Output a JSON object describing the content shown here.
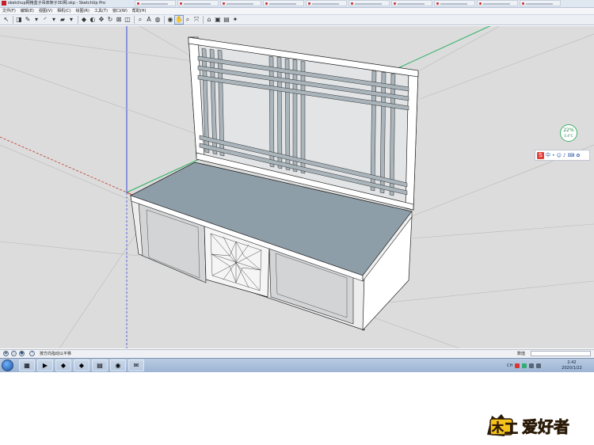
{
  "window": {
    "title": "sketchup网格盒子吊床架子3D网.skp - SketchUp Pro"
  },
  "menu": {
    "items": [
      "文件(F)",
      "编辑(E)",
      "视图(V)",
      "相机(C)",
      "绘图(R)",
      "工具(T)",
      "窗口(W)",
      "帮助(H)"
    ]
  },
  "toolbar": {
    "tools": [
      {
        "name": "select-tool-icon",
        "glyph": "↖"
      },
      {
        "name": "eraser-tool-icon",
        "glyph": "◨"
      },
      {
        "name": "pencil-tool-icon",
        "glyph": "✎"
      },
      {
        "name": "dropdown-icon",
        "glyph": "▾"
      },
      {
        "name": "arc-tool-icon",
        "glyph": "◜"
      },
      {
        "name": "dropdown-icon",
        "glyph": "▾"
      },
      {
        "name": "shape-tool-icon",
        "glyph": "▰"
      },
      {
        "name": "dropdown-icon",
        "glyph": "▾"
      },
      {
        "name": "push-pull-icon",
        "glyph": "◆"
      },
      {
        "name": "follow-me-icon",
        "glyph": "◐"
      },
      {
        "name": "move-tool-icon",
        "glyph": "✥"
      },
      {
        "name": "rotate-tool-icon",
        "glyph": "↻"
      },
      {
        "name": "scale-tool-icon",
        "glyph": "⊠"
      },
      {
        "name": "offset-tool-icon",
        "glyph": "◫"
      },
      {
        "name": "tape-measure-icon",
        "glyph": "⌕"
      },
      {
        "name": "text-tool-icon",
        "glyph": "A"
      },
      {
        "name": "paint-bucket-icon",
        "glyph": "◍"
      },
      {
        "name": "orbit-tool-icon",
        "glyph": "◉"
      },
      {
        "name": "pan-tool-icon",
        "glyph": "✋"
      },
      {
        "name": "zoom-tool-icon",
        "glyph": "⌕"
      },
      {
        "name": "zoom-extents-icon",
        "glyph": "⤧"
      },
      {
        "name": "warehouse-icon",
        "glyph": "⌂"
      },
      {
        "name": "extension-warehouse-icon",
        "glyph": "▣"
      },
      {
        "name": "layout-icon",
        "glyph": "▤"
      },
      {
        "name": "extension-manager-icon",
        "glyph": "✦"
      }
    ]
  },
  "zoom_widget": {
    "percent": "22%",
    "sub": "0.4°C"
  },
  "ime": {
    "logo": "S"
  },
  "status": {
    "hint": "按方向指动以平移",
    "measure_label": "数值"
  },
  "tray": {
    "lang": "CH"
  },
  "clock": {
    "time": "2:42",
    "date": "2020/1/22"
  },
  "brand": {
    "text": "木工爱好者"
  },
  "colors": {
    "viewport": "#dcdcdc",
    "tabletop": "#8e9ea8",
    "frame": "#ffffff",
    "glass": "#d2d4d6",
    "slat": "#9aa7af",
    "axis_red": "#c0392b",
    "axis_green": "#27ae60",
    "axis_blue": "#3b4bd8"
  }
}
